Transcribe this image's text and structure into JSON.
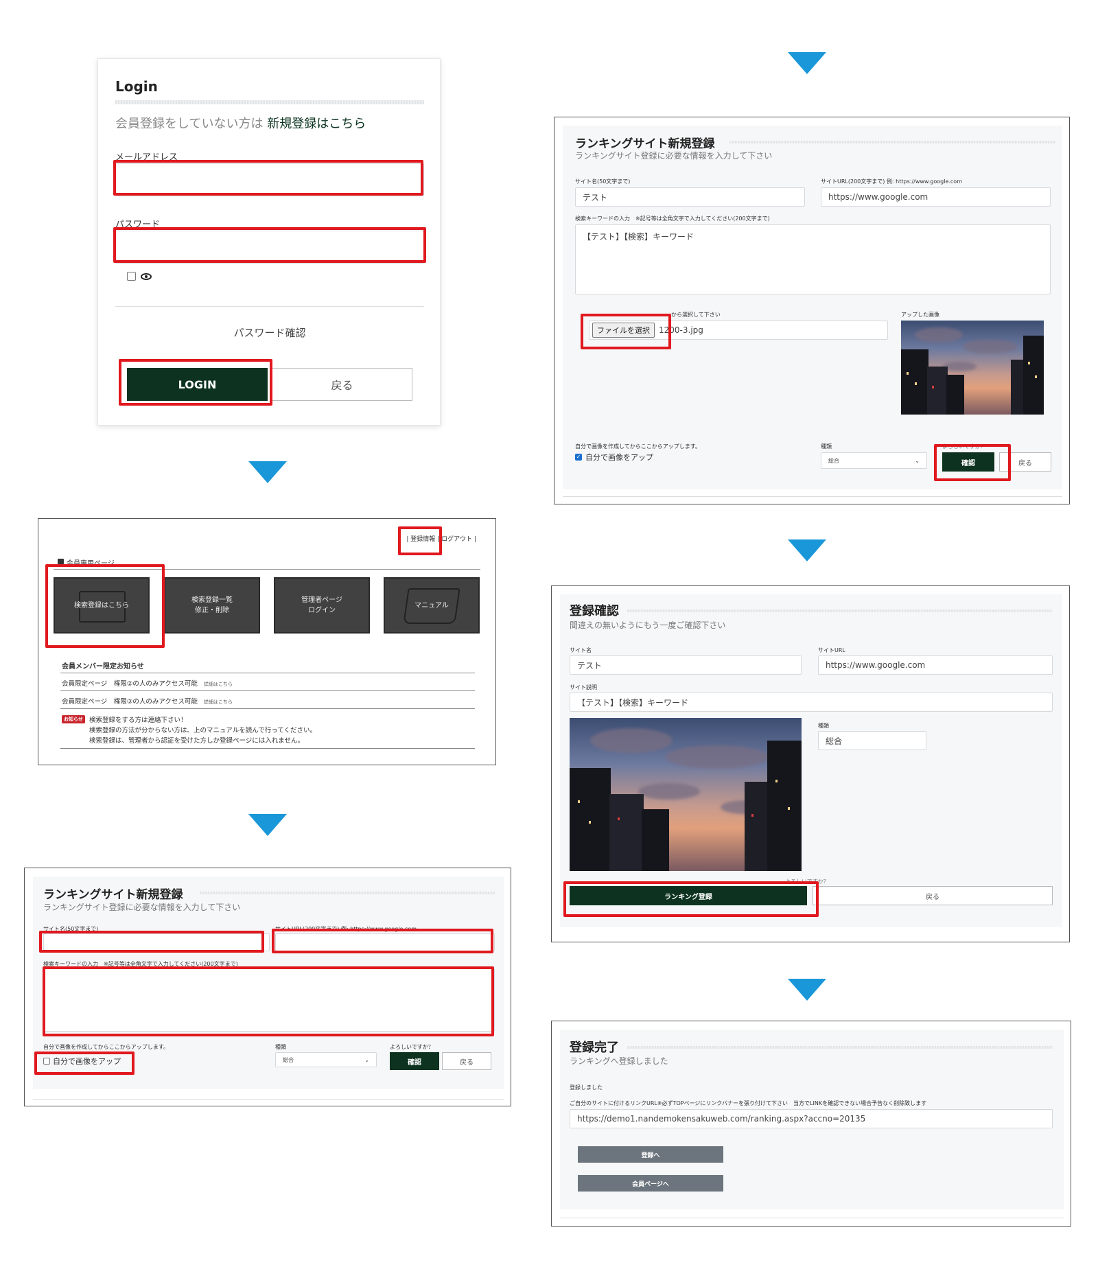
{
  "login": {
    "title": "Login",
    "note_prefix": "会員登録をしていない方は",
    "note_link": "新規登録はこちら",
    "email_label": "メールアドレス",
    "password_label": "パスワード",
    "password_confirm": "パスワード確認",
    "login_button": "LOGIN",
    "back_button": "戻る"
  },
  "member": {
    "header_links": [
      "登録情報",
      "ログアウト"
    ],
    "section_label": "会員専用ページ",
    "tiles": [
      {
        "line1": "検索登録はこちら",
        "line2": ""
      },
      {
        "line1": "検索登録一覧",
        "line2": "修正・削除"
      },
      {
        "line1": "管理者ページ",
        "line2": "ログイン"
      },
      {
        "line1": "マニュアル",
        "line2": ""
      }
    ],
    "news_heading": "会員メンバー限定お知らせ",
    "news": [
      {
        "text": "会員限定ページ　権限②の人のみアクセス可能",
        "link": "詳細はこちら"
      },
      {
        "text": "会員限定ページ　権限③の人のみアクセス可能",
        "link": "詳細はこちら"
      }
    ],
    "notice_badge": "お知らせ",
    "notice_lines": [
      "検索登録をする方は連絡下さい！",
      "検索登録の方法が分からない方は、上のマニュアルを読んで行ってください。",
      "検索登録は、管理者から認証を受けた方しか登録ページには入れません。"
    ]
  },
  "regform_empty": {
    "title": "ランキングサイト新規登録",
    "subtitle": "ランキングサイト登録に必要な情報を入力して下さい",
    "site_name_label": "サイト名(50文字まで)",
    "site_url_label": "サイトURL(200文字まで) 例: https://www.google.com",
    "keyword_label": "検索キーワードの入力　※記号等は全角文字で入力してください(200文字まで)",
    "upload_note": "自分で画像を作成してからここからアップします。",
    "upload_checkbox": "自分で画像をアップ",
    "kind_label": "種類",
    "kind_value": "総合",
    "confirm_q": "よろしいですか？",
    "confirm_button": "確認",
    "back_button": "戻る"
  },
  "regform_filled": {
    "title": "ランキングサイト新規登録",
    "subtitle": "ランキングサイト登録に必要な情報を入力して下さい",
    "site_name_label": "サイト名(50文字まで)",
    "site_name_value": "テスト",
    "site_url_label": "サイトURL(200文字まで) 例: https://www.google.com",
    "site_url_value": "https://www.google.com",
    "keyword_label": "検索キーワードの入力　※記号等は全角文字で入力してください(200文字まで)",
    "keyword_value": "【テスト】【検索】キーワード",
    "file_label": "から選択して下さい",
    "file_button": "ファイルを選択",
    "file_name": "1200-3.jpg",
    "uploaded_label": "アップした画像",
    "upload_note": "自分で画像を作成してからここからアップします。",
    "upload_checkbox": "自分で画像をアップ",
    "kind_label": "種類",
    "kind_value": "総合",
    "confirm_q": "よろしいですか？",
    "confirm_button": "確認",
    "back_button": "戻る"
  },
  "confirm": {
    "title": "登録確認",
    "subtitle": "間違えの無いようにもう一度ご確認下さい",
    "site_name_label": "サイト名",
    "site_name_value": "テスト",
    "site_url_label": "サイトURL",
    "site_url_value": "https://www.google.com",
    "desc_label": "サイト説明",
    "desc_value": "【テスト】【検索】キーワード",
    "kind_label": "種類",
    "kind_value": "総合",
    "confirm_q": "よろしいですか？",
    "register_button": "ランキング登録",
    "back_button": "戻る"
  },
  "complete": {
    "title": "登録完了",
    "subtitle": "ランキングへ登録しました",
    "done_text": "登録しました",
    "link_note": "ご自分のサイトに付けるリンクURL※必ずTOPページにリンクバナーを張り付けて下さい　当方でLINKを確認できない場合予告なく削除致します",
    "link_url": "https://demo1.nandemokensakuweb.com/ranking.aspx?accno=20135",
    "to_register_button": "登録へ",
    "to_member_button": "会員ページへ"
  },
  "colors": {
    "arrow": "#1a97d8",
    "highlight": "#e0191f",
    "dark_button": "#0d3320"
  }
}
